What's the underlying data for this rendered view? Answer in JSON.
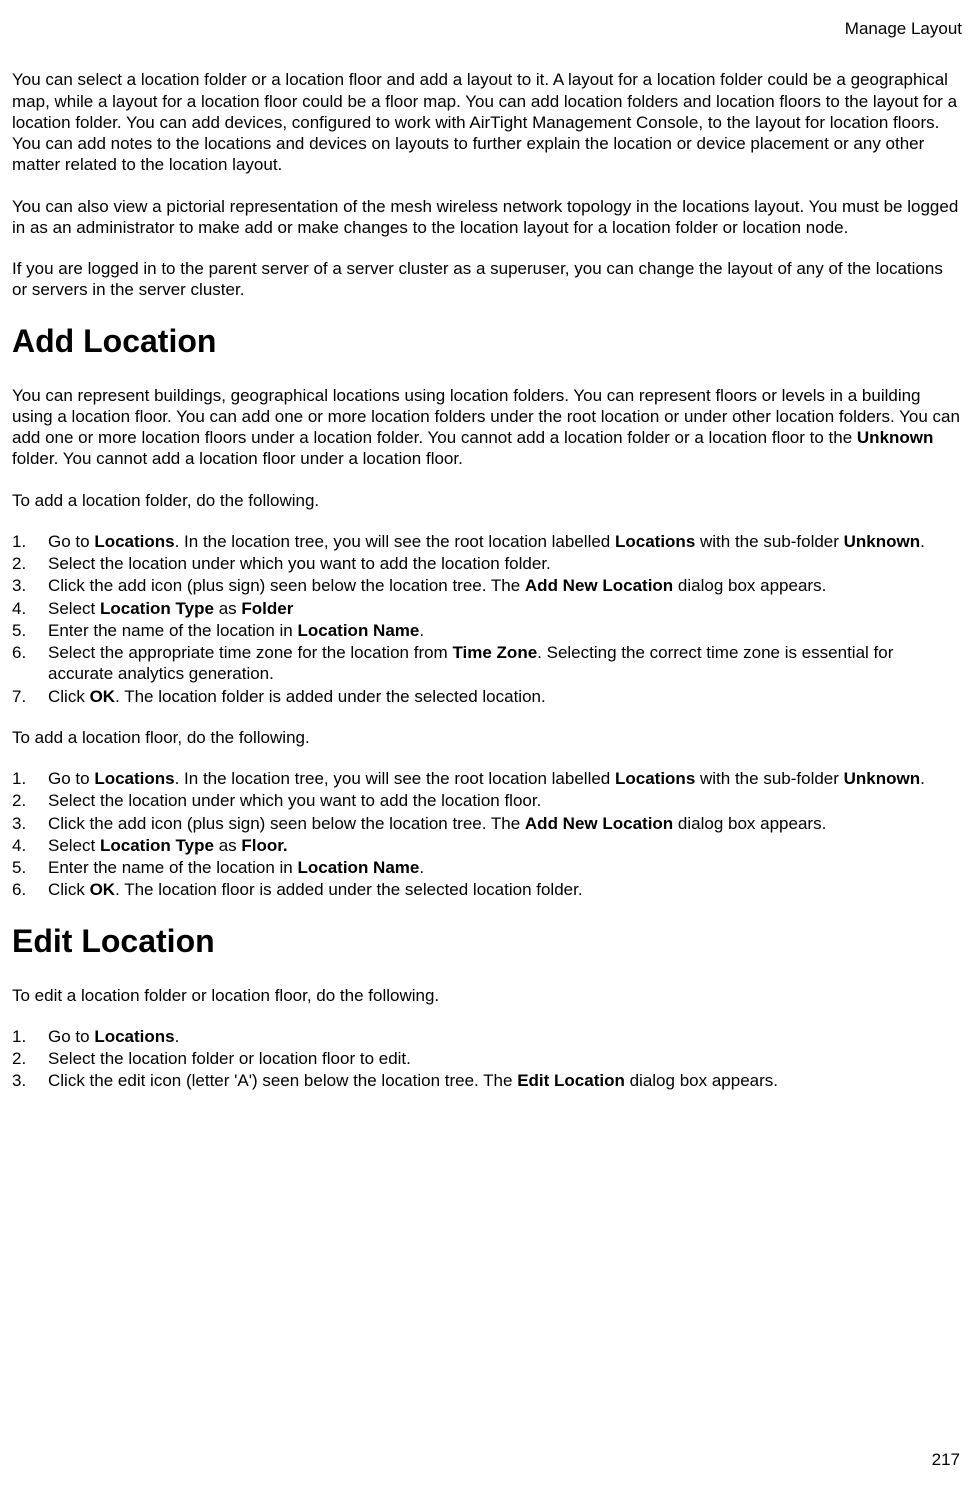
{
  "header": {
    "right": "Manage Layout"
  },
  "intro": {
    "p1": "You can select a location folder or a location floor and add a layout to it. A layout for a location folder could be a geographical map, while a layout for a location floor could be a floor map. You can add location folders and location floors to the layout for a location folder. You can add devices, configured to work with AirTight Management Console, to the layout for location floors. You can add notes to the locations and devices on layouts to further explain the location or device placement or any other matter related to the location layout.",
    "p2": "You can also view a pictorial representation of the mesh wireless network topology in the locations layout. You must be logged in as an administrator to make add or make changes to the location layout for a location folder or location node.",
    "p3": "If you are logged in to the parent server of a server cluster as a superuser, you can change the layout of any of the locations or servers in the server cluster."
  },
  "add_location": {
    "heading": "Add Location",
    "intro_a": "You can represent buildings, geographical locations using location folders. You can represent floors or levels in a building using a location floor. You can add one or more location folders under the root location or under other location folders. You can add one or more location floors under a location folder. You cannot add a location folder or a location floor to the ",
    "intro_bold": "Unknown",
    "intro_b": " folder. You cannot add a location floor under a location floor.",
    "folder_lead": "To add a location folder, do the following.",
    "folder_steps_pre": {
      "s1a": "Go to ",
      "s1b": "Locations",
      "s1c": ". In the location tree, you will see the root location labelled ",
      "s1d": "Locations",
      "s1e": " with the sub-folder ",
      "s1f": "Unknown",
      "s1g": "."
    },
    "folder_steps": {
      "s2": "Select the location under which you want to add the location folder.",
      "s3a": "Click the add icon (plus sign) seen below the location tree. The ",
      "s3b": "Add New Location",
      "s3c": " dialog box appears.",
      "s4a": "Select ",
      "s4b": "Location Type",
      "s4c": " as ",
      "s4d": "Folder",
      "s5a": "Enter the name of the location in ",
      "s5b": "Location Name",
      "s5c": ".",
      "s6a": "Select the appropriate time zone for the location from ",
      "s6b": "Time Zone",
      "s6c": ". Selecting the correct time zone is essential for accurate analytics generation.",
      "s7a": "Click ",
      "s7b": "OK",
      "s7c": ". The location folder is added under the selected location."
    },
    "floor_lead": "To add a location floor, do the following.",
    "floor_steps": {
      "s1a": "Go to ",
      "s1b": "Locations",
      "s1c": ". In the location tree, you will see the root location labelled ",
      "s1d": "Locations",
      "s1e": " with the sub-folder ",
      "s1f": "Unknown",
      "s1g": ".",
      "s2": "Select the location under which you want to add the location floor.",
      "s3a": "Click the add icon (plus sign) seen below the location tree. The ",
      "s3b": "Add New Location",
      "s3c": " dialog box appears.",
      "s4a": "Select ",
      "s4b": "Location Type",
      "s4c": " as ",
      "s4d": "Floor.",
      "s5a": "Enter the name of the location in ",
      "s5b": "Location Name",
      "s5c": ".",
      "s6a": "Click ",
      "s6b": "OK",
      "s6c": ". The location floor is added under the selected location folder."
    }
  },
  "edit_location": {
    "heading": "Edit Location",
    "lead": "To edit a location folder or location floor, do the following.",
    "steps": {
      "s1a": "Go to ",
      "s1b": "Locations",
      "s1c": ".",
      "s2": "Select the location folder or location floor to edit.",
      "s3a": "Click the edit icon (letter 'A') seen below the location tree. The ",
      "s3b": "Edit Location",
      "s3c": " dialog box appears."
    }
  },
  "page_number": "217"
}
